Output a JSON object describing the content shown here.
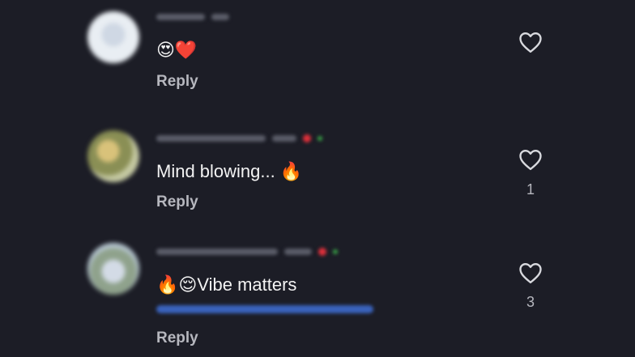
{
  "comments": [
    {
      "text": "😍❤️",
      "reply_label": "Reply",
      "like_count": ""
    },
    {
      "text": "Mind blowing... 🔥",
      "reply_label": "Reply",
      "like_count": "1"
    },
    {
      "text": "🔥😌Vibe matters",
      "reply_label": "Reply",
      "like_count": "3"
    }
  ],
  "icons": {
    "like": "heart-outline-icon"
  },
  "colors": {
    "background": "#1c1d26",
    "text": "#f3f3f3",
    "muted": "#b6b7be",
    "mention": "#3f6fd6",
    "badge_red": "#e0303b",
    "badge_green": "#3aa648"
  }
}
